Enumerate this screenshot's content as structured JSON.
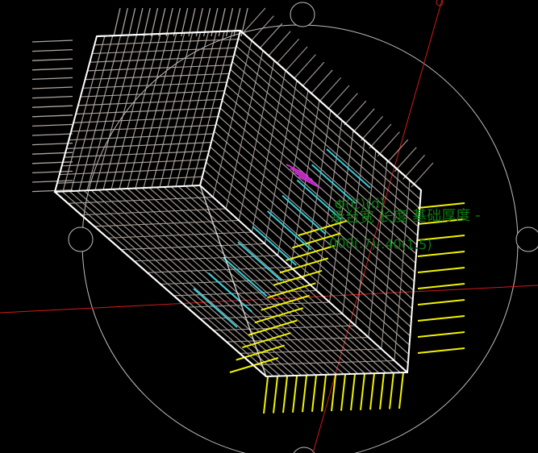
{
  "viewport": {
    "background": "#000000"
  },
  "colors": {
    "rebar_gray": "#b8aea7",
    "edge_white": "#ffffff",
    "axis_red": "#d21a1a",
    "yellow_bars": "#f2f200",
    "cyan_bars": "#39d9e7",
    "magenta_bars": "#d632d8",
    "text_green": "#0b7a12",
    "circle_gray": "#bdbdbd"
  },
  "labels": {
    "label_1": "Φ(C)(d)",
    "label_2": "承台宽 长度 基础厚度 -",
    "label_3": "000(.7)-.40(1.5)"
  }
}
